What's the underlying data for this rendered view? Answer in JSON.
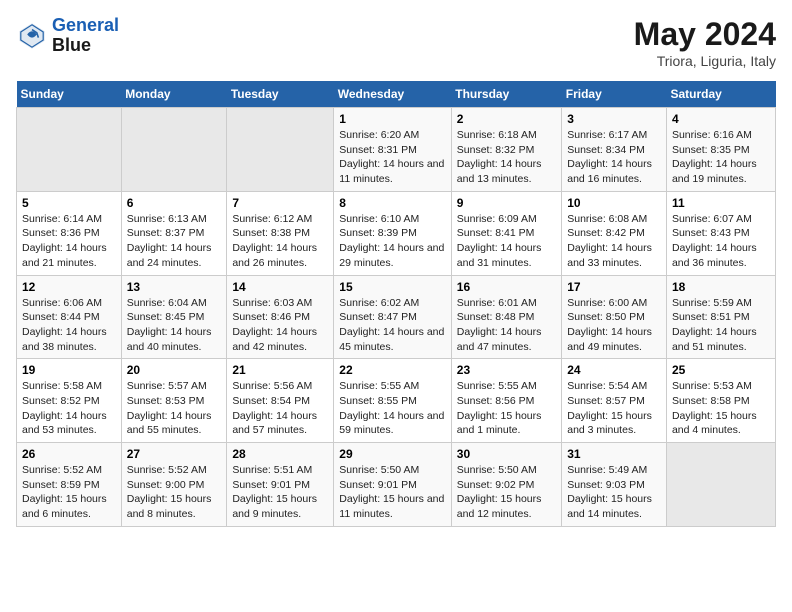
{
  "header": {
    "logo_line1": "General",
    "logo_line2": "Blue",
    "title": "May 2024",
    "subtitle": "Triora, Liguria, Italy"
  },
  "weekdays": [
    "Sunday",
    "Monday",
    "Tuesday",
    "Wednesday",
    "Thursday",
    "Friday",
    "Saturday"
  ],
  "weeks": [
    [
      {
        "day": "",
        "sunrise": "",
        "sunset": "",
        "daylight": ""
      },
      {
        "day": "",
        "sunrise": "",
        "sunset": "",
        "daylight": ""
      },
      {
        "day": "",
        "sunrise": "",
        "sunset": "",
        "daylight": ""
      },
      {
        "day": "1",
        "sunrise": "Sunrise: 6:20 AM",
        "sunset": "Sunset: 8:31 PM",
        "daylight": "Daylight: 14 hours and 11 minutes."
      },
      {
        "day": "2",
        "sunrise": "Sunrise: 6:18 AM",
        "sunset": "Sunset: 8:32 PM",
        "daylight": "Daylight: 14 hours and 13 minutes."
      },
      {
        "day": "3",
        "sunrise": "Sunrise: 6:17 AM",
        "sunset": "Sunset: 8:34 PM",
        "daylight": "Daylight: 14 hours and 16 minutes."
      },
      {
        "day": "4",
        "sunrise": "Sunrise: 6:16 AM",
        "sunset": "Sunset: 8:35 PM",
        "daylight": "Daylight: 14 hours and 19 minutes."
      }
    ],
    [
      {
        "day": "5",
        "sunrise": "Sunrise: 6:14 AM",
        "sunset": "Sunset: 8:36 PM",
        "daylight": "Daylight: 14 hours and 21 minutes."
      },
      {
        "day": "6",
        "sunrise": "Sunrise: 6:13 AM",
        "sunset": "Sunset: 8:37 PM",
        "daylight": "Daylight: 14 hours and 24 minutes."
      },
      {
        "day": "7",
        "sunrise": "Sunrise: 6:12 AM",
        "sunset": "Sunset: 8:38 PM",
        "daylight": "Daylight: 14 hours and 26 minutes."
      },
      {
        "day": "8",
        "sunrise": "Sunrise: 6:10 AM",
        "sunset": "Sunset: 8:39 PM",
        "daylight": "Daylight: 14 hours and 29 minutes."
      },
      {
        "day": "9",
        "sunrise": "Sunrise: 6:09 AM",
        "sunset": "Sunset: 8:41 PM",
        "daylight": "Daylight: 14 hours and 31 minutes."
      },
      {
        "day": "10",
        "sunrise": "Sunrise: 6:08 AM",
        "sunset": "Sunset: 8:42 PM",
        "daylight": "Daylight: 14 hours and 33 minutes."
      },
      {
        "day": "11",
        "sunrise": "Sunrise: 6:07 AM",
        "sunset": "Sunset: 8:43 PM",
        "daylight": "Daylight: 14 hours and 36 minutes."
      }
    ],
    [
      {
        "day": "12",
        "sunrise": "Sunrise: 6:06 AM",
        "sunset": "Sunset: 8:44 PM",
        "daylight": "Daylight: 14 hours and 38 minutes."
      },
      {
        "day": "13",
        "sunrise": "Sunrise: 6:04 AM",
        "sunset": "Sunset: 8:45 PM",
        "daylight": "Daylight: 14 hours and 40 minutes."
      },
      {
        "day": "14",
        "sunrise": "Sunrise: 6:03 AM",
        "sunset": "Sunset: 8:46 PM",
        "daylight": "Daylight: 14 hours and 42 minutes."
      },
      {
        "day": "15",
        "sunrise": "Sunrise: 6:02 AM",
        "sunset": "Sunset: 8:47 PM",
        "daylight": "Daylight: 14 hours and 45 minutes."
      },
      {
        "day": "16",
        "sunrise": "Sunrise: 6:01 AM",
        "sunset": "Sunset: 8:48 PM",
        "daylight": "Daylight: 14 hours and 47 minutes."
      },
      {
        "day": "17",
        "sunrise": "Sunrise: 6:00 AM",
        "sunset": "Sunset: 8:50 PM",
        "daylight": "Daylight: 14 hours and 49 minutes."
      },
      {
        "day": "18",
        "sunrise": "Sunrise: 5:59 AM",
        "sunset": "Sunset: 8:51 PM",
        "daylight": "Daylight: 14 hours and 51 minutes."
      }
    ],
    [
      {
        "day": "19",
        "sunrise": "Sunrise: 5:58 AM",
        "sunset": "Sunset: 8:52 PM",
        "daylight": "Daylight: 14 hours and 53 minutes."
      },
      {
        "day": "20",
        "sunrise": "Sunrise: 5:57 AM",
        "sunset": "Sunset: 8:53 PM",
        "daylight": "Daylight: 14 hours and 55 minutes."
      },
      {
        "day": "21",
        "sunrise": "Sunrise: 5:56 AM",
        "sunset": "Sunset: 8:54 PM",
        "daylight": "Daylight: 14 hours and 57 minutes."
      },
      {
        "day": "22",
        "sunrise": "Sunrise: 5:55 AM",
        "sunset": "Sunset: 8:55 PM",
        "daylight": "Daylight: 14 hours and 59 minutes."
      },
      {
        "day": "23",
        "sunrise": "Sunrise: 5:55 AM",
        "sunset": "Sunset: 8:56 PM",
        "daylight": "Daylight: 15 hours and 1 minute."
      },
      {
        "day": "24",
        "sunrise": "Sunrise: 5:54 AM",
        "sunset": "Sunset: 8:57 PM",
        "daylight": "Daylight: 15 hours and 3 minutes."
      },
      {
        "day": "25",
        "sunrise": "Sunrise: 5:53 AM",
        "sunset": "Sunset: 8:58 PM",
        "daylight": "Daylight: 15 hours and 4 minutes."
      }
    ],
    [
      {
        "day": "26",
        "sunrise": "Sunrise: 5:52 AM",
        "sunset": "Sunset: 8:59 PM",
        "daylight": "Daylight: 15 hours and 6 minutes."
      },
      {
        "day": "27",
        "sunrise": "Sunrise: 5:52 AM",
        "sunset": "Sunset: 9:00 PM",
        "daylight": "Daylight: 15 hours and 8 minutes."
      },
      {
        "day": "28",
        "sunrise": "Sunrise: 5:51 AM",
        "sunset": "Sunset: 9:01 PM",
        "daylight": "Daylight: 15 hours and 9 minutes."
      },
      {
        "day": "29",
        "sunrise": "Sunrise: 5:50 AM",
        "sunset": "Sunset: 9:01 PM",
        "daylight": "Daylight: 15 hours and 11 minutes."
      },
      {
        "day": "30",
        "sunrise": "Sunrise: 5:50 AM",
        "sunset": "Sunset: 9:02 PM",
        "daylight": "Daylight: 15 hours and 12 minutes."
      },
      {
        "day": "31",
        "sunrise": "Sunrise: 5:49 AM",
        "sunset": "Sunset: 9:03 PM",
        "daylight": "Daylight: 15 hours and 14 minutes."
      },
      {
        "day": "",
        "sunrise": "",
        "sunset": "",
        "daylight": ""
      }
    ]
  ]
}
